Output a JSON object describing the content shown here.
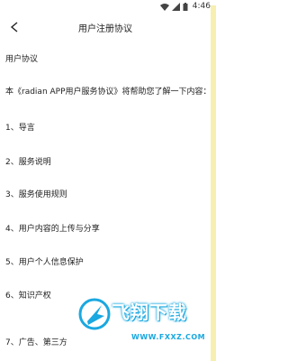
{
  "status_bar": {
    "time": "4:46"
  },
  "header": {
    "title": "用户注册协议",
    "back_icon": "chevron-left-icon"
  },
  "content": {
    "section_title": "用户协议",
    "intro": "本《radian APP用户服务协议》将帮助您了解一下内容：",
    "items": [
      "1、导言",
      "2、服务说明",
      "3、服务使用规则",
      "4、用户内容的上传与分享",
      "5、用户个人信息保护",
      "6、知识产权",
      "7、广告、第三方"
    ]
  },
  "watermark": {
    "title": "飞翔下载",
    "url": "WWW.FXXZ.COM"
  },
  "colors": {
    "accent_strip": "#f6efb1",
    "watermark": "#1aa8e0"
  }
}
